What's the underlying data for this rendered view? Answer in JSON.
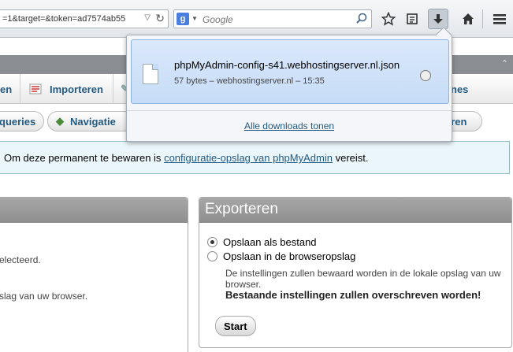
{
  "browser": {
    "url_fragment": "=1&target=&token=ad7574ab55",
    "search_placeholder": "Google",
    "search_engine_icon": "google-icon"
  },
  "tabs": {
    "left_partial": "en",
    "importeren": "Importeren",
    "right_partial": "nes"
  },
  "pills": {
    "left_partial": "queries",
    "navigatie_partial": "Navigatie",
    "right_partial": "eren"
  },
  "notice": {
    "prefix": "Om deze permanent te bewaren is",
    "link": "configuratie-opslag van phpMyAdmin",
    "suffix": "vereist."
  },
  "left_panel": {
    "line1": "electeerd.",
    "line2": "slag van uw browser."
  },
  "export_panel": {
    "title": "Exporteren",
    "options": [
      {
        "label": "Opslaan als bestand",
        "selected": true
      },
      {
        "label": "Opslaan in de browseropslag",
        "selected": false
      }
    ],
    "description": "De instellingen zullen bewaard worden in de lokale opslag van uw browser.",
    "warning": "Bestaande instellingen zullen overschreven worden!",
    "start_label": "Start"
  },
  "downloads": {
    "filename": "phpMyAdmin-config-s41.webhostingserver.nl.json",
    "meta": "57 bytes – webhostingserver.nl – 15:35",
    "show_all": "Alle downloads tonen"
  }
}
